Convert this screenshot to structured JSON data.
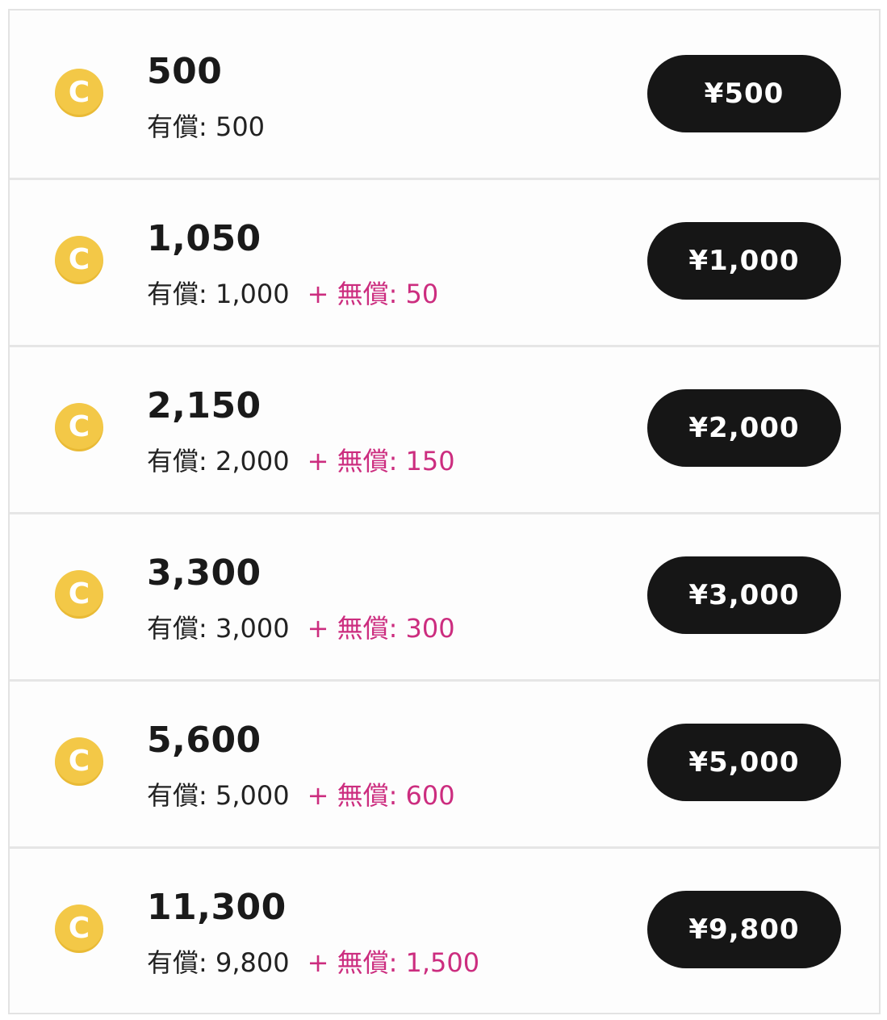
{
  "coin_icon": {
    "name": "coin-icon",
    "letter": "C",
    "color": "#f3c847"
  },
  "colors": {
    "bonus": "#cc2d7f",
    "button_bg": "#161616",
    "button_text": "#ffffff"
  },
  "packages": [
    {
      "amount": "500",
      "paid": "有償: 500",
      "bonus": "",
      "price": "¥500"
    },
    {
      "amount": "1,050",
      "paid": "有償: 1,000",
      "bonus": "+ 無償: 50",
      "price": "¥1,000"
    },
    {
      "amount": "2,150",
      "paid": "有償: 2,000",
      "bonus": "+ 無償: 150",
      "price": "¥2,000"
    },
    {
      "amount": "3,300",
      "paid": "有償: 3,000",
      "bonus": "+ 無償: 300",
      "price": "¥3,000"
    },
    {
      "amount": "5,600",
      "paid": "有償: 5,000",
      "bonus": "+ 無償: 600",
      "price": "¥5,000"
    },
    {
      "amount": "11,300",
      "paid": "有償: 9,800",
      "bonus": "+ 無償: 1,500",
      "price": "¥9,800"
    }
  ]
}
